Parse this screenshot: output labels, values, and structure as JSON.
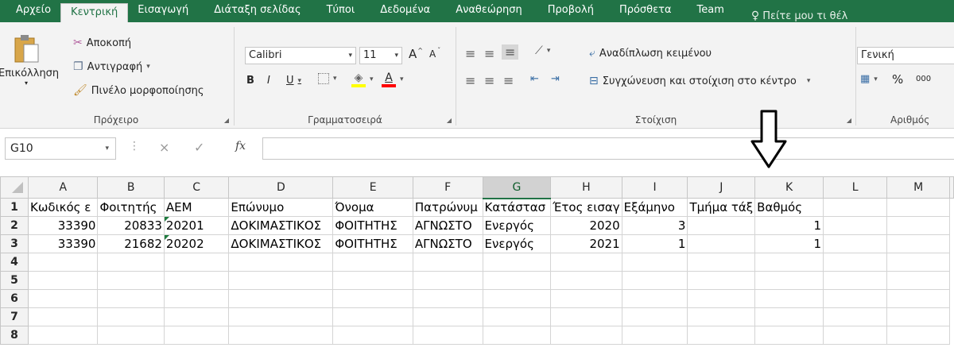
{
  "tabs": [
    "Αρχείο",
    "Κεντρική",
    "Εισαγωγή",
    "Διάταξη σελίδας",
    "Τύποι",
    "Δεδομένα",
    "Αναθεώρηση",
    "Προβολή",
    "Πρόσθετα",
    "Team"
  ],
  "tell_me": "Πείτε μου τι θέλ",
  "clipboard": {
    "paste": "Επικόλληση",
    "cut": "Αποκοπή",
    "copy": "Αντιγραφή",
    "format_painter": "Πινέλο μορφοποίησης",
    "label": "Πρόχειρο"
  },
  "font": {
    "name": "Calibri",
    "size": "11",
    "bold": "B",
    "italic": "I",
    "underline": "U",
    "font_color": "A",
    "grow": "A",
    "shrink": "A",
    "label": "Γραμματοσειρά"
  },
  "alignment": {
    "wrap_text": "Αναδίπλωση κειμένου",
    "merge_center": "Συγχώνευση και στοίχιση στο κέντρο",
    "label": "Στοίχιση"
  },
  "number": {
    "format": "Γενική",
    "percent": "%",
    "thousands": "000",
    "label": "Αριθμός"
  },
  "formula_bar": {
    "name_box": "G10",
    "cancel": "×",
    "enter": "✓",
    "fx": "fx",
    "value": ""
  },
  "sheet": {
    "columns": [
      "A",
      "B",
      "C",
      "D",
      "E",
      "F",
      "G",
      "H",
      "I",
      "J",
      "K",
      "L",
      "M"
    ],
    "selected_column": "G",
    "rows": [
      [
        "1",
        "Κωδικός ε",
        "Φοιτητής",
        "ΑΕΜ",
        "Επώνυμο",
        "Όνομα",
        "Πατρώνυμ",
        "Κατάστασ",
        "Έτος εισαγ",
        "Εξάμηνο",
        "Τμήμα τάξ",
        "Βαθμός",
        "",
        ""
      ],
      [
        "2",
        "33390",
        "20833",
        "20201",
        "ΔΟΚΙΜΑΣΤΙΚΟΣ",
        "ΦΟΙΤΗΤΗΣ",
        "ΑΓΝΩΣΤΟ",
        "Ενεργός",
        "2020",
        "3",
        "",
        "1",
        "",
        ""
      ],
      [
        "3",
        "33390",
        "21682",
        "20202",
        "ΔΟΚΙΜΑΣΤΙΚΟΣ",
        "ΦΟΙΤΗΤΗΣ",
        "ΑΓΝΩΣΤΟ",
        "Ενεργός",
        "2021",
        "1",
        "",
        "1",
        "",
        ""
      ],
      [
        "4",
        "",
        "",
        "",
        "",
        "",
        "",
        "",
        "",
        "",
        "",
        "",
        "",
        ""
      ],
      [
        "5",
        "",
        "",
        "",
        "",
        "",
        "",
        "",
        "",
        "",
        "",
        "",
        "",
        ""
      ],
      [
        "6",
        "",
        "",
        "",
        "",
        "",
        "",
        "",
        "",
        "",
        "",
        "",
        "",
        ""
      ],
      [
        "7",
        "",
        "",
        "",
        "",
        "",
        "",
        "",
        "",
        "",
        "",
        "",
        "",
        ""
      ],
      [
        "8",
        "",
        "",
        "",
        "",
        "",
        "",
        "",
        "",
        "",
        "",
        "",
        "",
        ""
      ]
    ]
  },
  "colors": {
    "excel_green": "#217346",
    "highlight": "#ffff00",
    "font_red": "#ff0000"
  }
}
